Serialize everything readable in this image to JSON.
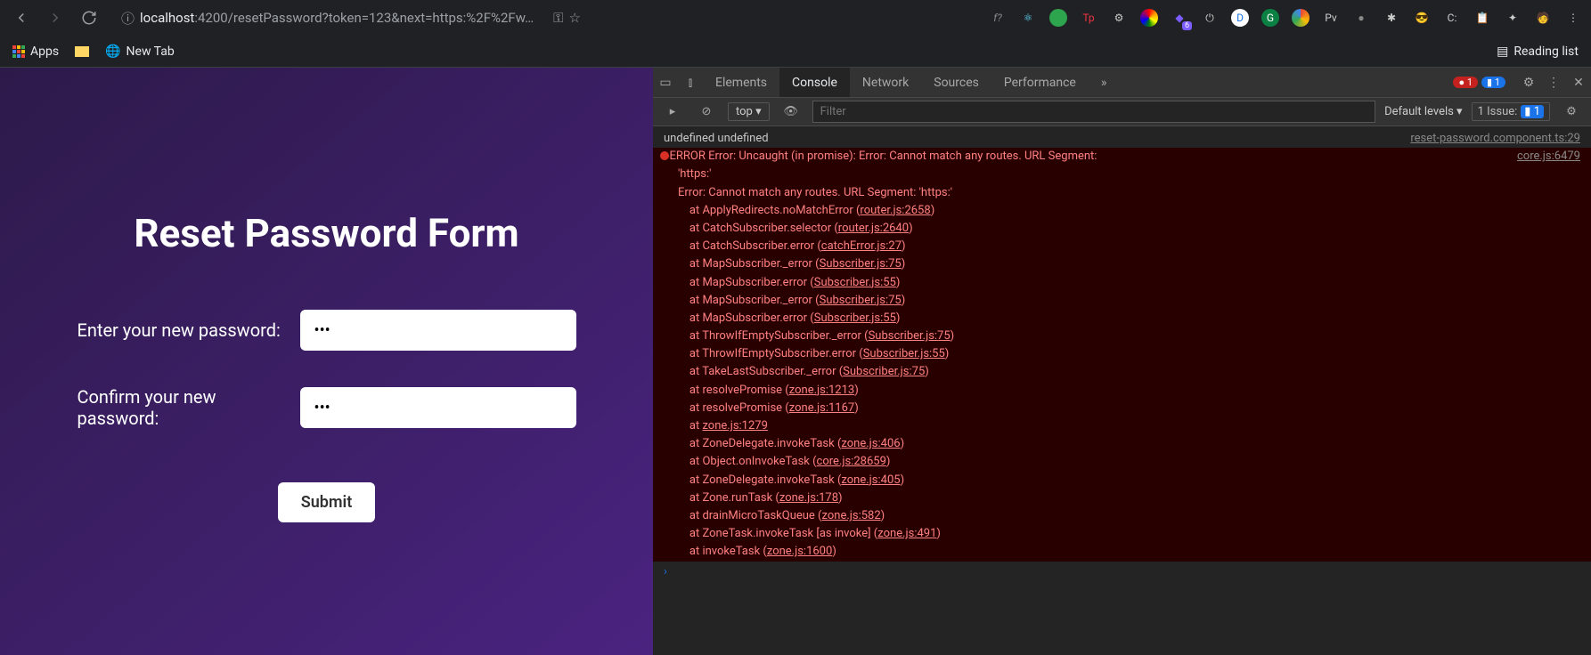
{
  "chrome": {
    "url_host": "localhost",
    "url_rest": ":4200/resetPassword?token=123&next=https:%2F%2Fw…"
  },
  "bookmarks": {
    "apps": "Apps",
    "newtab": "New Tab",
    "reading_list": "Reading list"
  },
  "page": {
    "title": "Reset Password Form",
    "label1": "Enter your new password:",
    "value1": "•••",
    "label2": "Confirm your new password:",
    "value2": "•••",
    "submit": "Submit"
  },
  "devtools": {
    "tabs": [
      "Elements",
      "Console",
      "Network",
      "Sources",
      "Performance"
    ],
    "more": "»",
    "err_count": "1",
    "msg_count": "1",
    "filter_placeholder": "Filter",
    "context": "top ▾",
    "levels": "Default levels ▾",
    "issue_label": "1 Issue:",
    "issue_count": "1",
    "log0_txt": "undefined undefined",
    "log0_src": "reset-password.component.ts:29",
    "err_lead": "▸ERROR Error: Uncaught (in promise): Error: Cannot match any routes. URL Segment:",
    "err_lead_src": "core.js:6479",
    "err_lead2": "'https:'",
    "err_line": "Error: Cannot match any routes. URL Segment: 'https:'",
    "stack": [
      {
        "t": "    at ApplyRedirects.noMatchError (",
        "l": "router.js:2658",
        "e": ")"
      },
      {
        "t": "    at CatchSubscriber.selector (",
        "l": "router.js:2640",
        "e": ")"
      },
      {
        "t": "    at CatchSubscriber.error (",
        "l": "catchError.js:27",
        "e": ")"
      },
      {
        "t": "    at MapSubscriber._error (",
        "l": "Subscriber.js:75",
        "e": ")"
      },
      {
        "t": "    at MapSubscriber.error (",
        "l": "Subscriber.js:55",
        "e": ")"
      },
      {
        "t": "    at MapSubscriber._error (",
        "l": "Subscriber.js:75",
        "e": ")"
      },
      {
        "t": "    at MapSubscriber.error (",
        "l": "Subscriber.js:55",
        "e": ")"
      },
      {
        "t": "    at ThrowIfEmptySubscriber._error (",
        "l": "Subscriber.js:75",
        "e": ")"
      },
      {
        "t": "    at ThrowIfEmptySubscriber.error (",
        "l": "Subscriber.js:55",
        "e": ")"
      },
      {
        "t": "    at TakeLastSubscriber._error (",
        "l": "Subscriber.js:75",
        "e": ")"
      },
      {
        "t": "    at resolvePromise (",
        "l": "zone.js:1213",
        "e": ")"
      },
      {
        "t": "    at resolvePromise (",
        "l": "zone.js:1167",
        "e": ")"
      },
      {
        "t": "    at ",
        "l": "zone.js:1279",
        "e": ""
      },
      {
        "t": "    at ZoneDelegate.invokeTask (",
        "l": "zone.js:406",
        "e": ")"
      },
      {
        "t": "    at Object.onInvokeTask (",
        "l": "core.js:28659",
        "e": ")"
      },
      {
        "t": "    at ZoneDelegate.invokeTask (",
        "l": "zone.js:405",
        "e": ")"
      },
      {
        "t": "    at Zone.runTask (",
        "l": "zone.js:178",
        "e": ")"
      },
      {
        "t": "    at drainMicroTaskQueue (",
        "l": "zone.js:582",
        "e": ")"
      },
      {
        "t": "    at ZoneTask.invokeTask [as invoke] (",
        "l": "zone.js:491",
        "e": ")"
      },
      {
        "t": "    at invokeTask (",
        "l": "zone.js:1600",
        "e": ")"
      }
    ],
    "prompt": "›"
  }
}
